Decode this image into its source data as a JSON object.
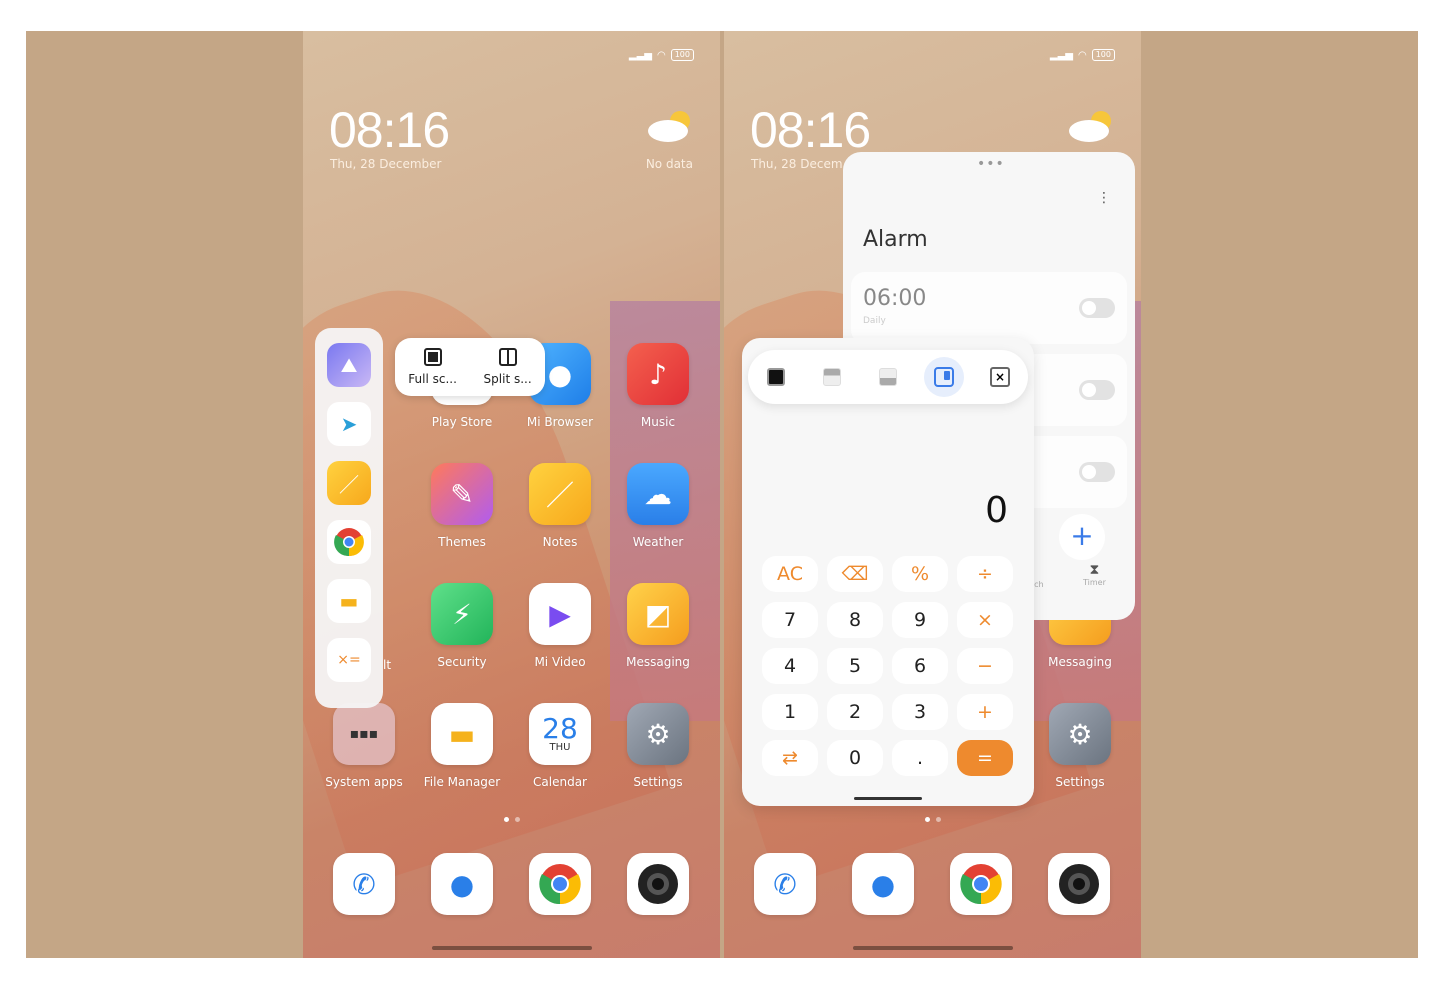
{
  "status": {
    "battery": "100"
  },
  "clock": {
    "time": "08:16",
    "date": "Thu, 28 December",
    "date_short": "Thu, 28 Decem",
    "weather": "No data"
  },
  "apps": {
    "row1": [
      "Play Store",
      "Mi Browser",
      "Music"
    ],
    "row2": [
      "Themes",
      "Notes",
      "Weather"
    ],
    "row3": [
      "Security",
      "Mi Video",
      "Messaging"
    ],
    "row3_partial": "lt",
    "row4": [
      "System apps",
      "File Manager",
      "Calendar",
      "Settings"
    ],
    "calendar_day": "28",
    "calendar_weekday": "THU"
  },
  "dock": [
    "Phone",
    "Messages",
    "Chrome",
    "Camera"
  ],
  "popup": {
    "full": "Full sc...",
    "split": "Split s..."
  },
  "sidebar": [
    "Gallery",
    "Telegram",
    "Notes",
    "Chrome",
    "File Manager",
    "Calculator"
  ],
  "alarm": {
    "title": "Alarm",
    "time": "06:00",
    "repeat": "Daily",
    "tab_partial": "tch",
    "tab_timer": "Timer",
    "add": "+"
  },
  "calc": {
    "display": "0",
    "keys": [
      [
        "AC",
        "⌫",
        "%",
        "÷"
      ],
      [
        "7",
        "8",
        "9",
        "×"
      ],
      [
        "4",
        "5",
        "6",
        "−"
      ],
      [
        "1",
        "2",
        "3",
        "+"
      ],
      [
        "⇄",
        "0",
        ".",
        "="
      ]
    ]
  },
  "colors": {
    "accent_orange": "#ee8a2e",
    "selected_blue": "#3a7be8"
  }
}
